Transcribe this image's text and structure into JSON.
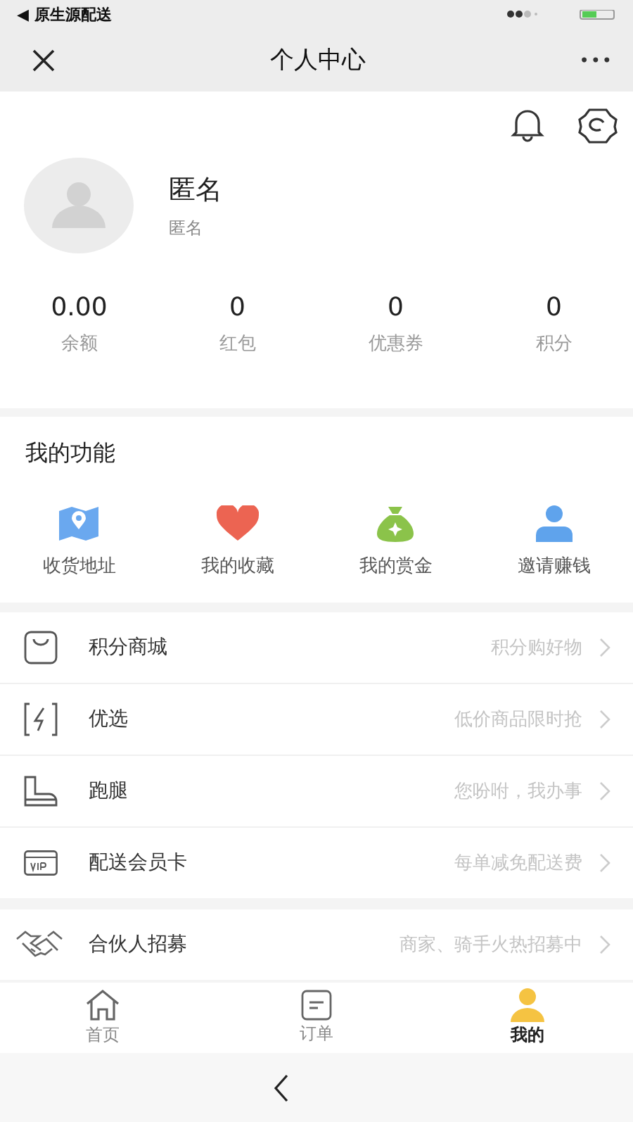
{
  "status_bar": {
    "back_label": "◀ 原生源配送"
  },
  "nav": {
    "title": "个人中心",
    "more": "•••"
  },
  "profile": {
    "name": "匿名",
    "subtitle": "匿名"
  },
  "stats": [
    {
      "value": "0.00",
      "label": "余额"
    },
    {
      "value": "0",
      "label": "红包"
    },
    {
      "value": "0",
      "label": "优惠券"
    },
    {
      "value": "0",
      "label": "积分"
    }
  ],
  "functions": {
    "title": "我的功能",
    "items": [
      {
        "label": "收货地址",
        "kind": "map"
      },
      {
        "label": "我的收藏",
        "kind": "heart"
      },
      {
        "label": "我的赏金",
        "kind": "moneybag"
      },
      {
        "label": "邀请赚钱",
        "kind": "person"
      }
    ]
  },
  "menu": [
    {
      "label": "积分商城",
      "hint": "积分购好物",
      "kind": "bag"
    },
    {
      "label": "优选",
      "hint": "低价商品限时抢",
      "kind": "bolt"
    },
    {
      "label": "跑腿",
      "hint": "您吩咐，我办事",
      "kind": "boot"
    },
    {
      "label": "配送会员卡",
      "hint": "每单减免配送费",
      "kind": "vip"
    }
  ],
  "partner": {
    "label": "合伙人招募",
    "hint": "商家、骑手火热招募中",
    "kind": "handshake"
  },
  "tabs": [
    {
      "label": "首页",
      "kind": "home",
      "selected": false
    },
    {
      "label": "订单",
      "kind": "order",
      "selected": false
    },
    {
      "label": "我的",
      "kind": "me",
      "selected": true
    }
  ]
}
